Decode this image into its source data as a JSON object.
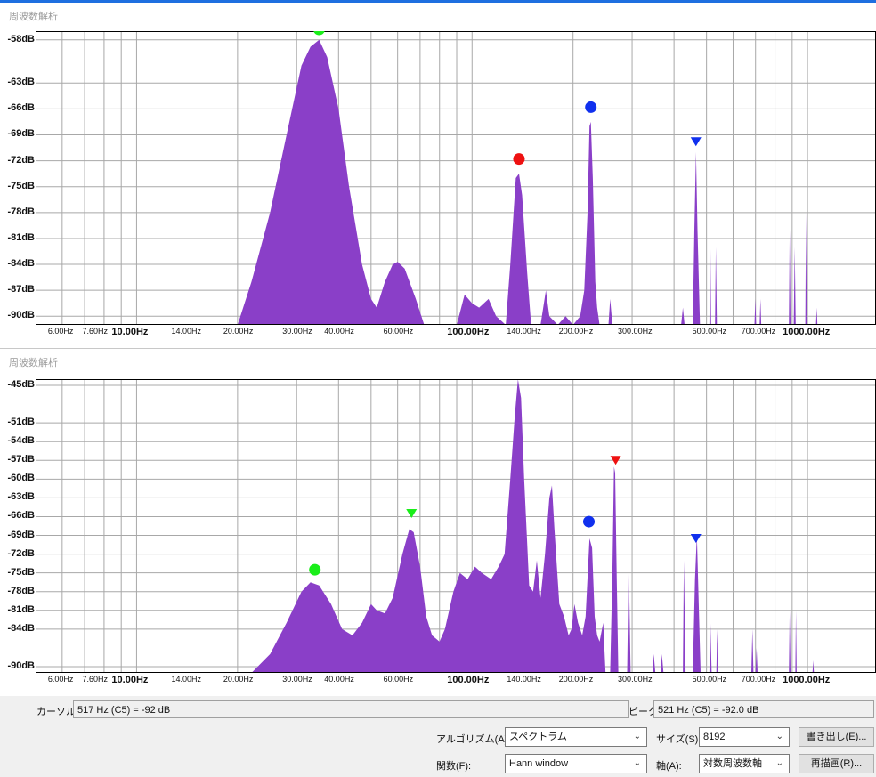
{
  "panel_title": "周波数解析",
  "colors": {
    "fill": "#8a3fc8",
    "grid": "#a8a8a8",
    "green": "#1aee1a",
    "red": "#ee1111",
    "blue": "#1030ee"
  },
  "x_ticks": [
    "6.00Hz",
    "7.60Hz",
    "10.00Hz",
    "14.00Hz",
    "20.00Hz",
    "30.00Hz",
    "40.00Hz",
    "60.00Hz",
    "100.00Hz",
    "140.00Hz",
    "200.00Hz",
    "300.00Hz",
    "500.00Hz",
    "700.00Hz",
    "1000.00Hz"
  ],
  "chart_data": [
    {
      "type": "area",
      "y_axis": {
        "scale": "dB",
        "ylim": [
          -91,
          -57
        ],
        "ticks": [
          "-58dB",
          "-63dB",
          "-66dB",
          "-69dB",
          "-72dB",
          "-75dB",
          "-78dB",
          "-81dB",
          "-84dB",
          "-87dB",
          "-90dB"
        ]
      },
      "x_axis": {
        "scale": "log",
        "xlim": [
          5,
          1600
        ],
        "unit": "Hz"
      },
      "series": [
        {
          "points": [
            [
              20,
              -91
            ],
            [
              22,
              -86
            ],
            [
              25,
              -78
            ],
            [
              28,
              -69
            ],
            [
              31,
              -61
            ],
            [
              33,
              -58.8
            ],
            [
              35,
              -58
            ],
            [
              37,
              -60
            ],
            [
              40,
              -66
            ],
            [
              43,
              -75
            ],
            [
              47,
              -84
            ],
            [
              50,
              -88
            ],
            [
              52,
              -89
            ],
            [
              55,
              -86
            ],
            [
              58,
              -84
            ],
            [
              60,
              -83.7
            ],
            [
              63,
              -84.5
            ],
            [
              68,
              -88
            ],
            [
              72,
              -91
            ],
            [
              90,
              -91
            ],
            [
              95,
              -87.5
            ],
            [
              100,
              -88.5
            ],
            [
              105,
              -89
            ],
            [
              112,
              -88
            ],
            [
              118,
              -90
            ],
            [
              126,
              -91
            ],
            [
              130,
              -84
            ],
            [
              135,
              -74
            ],
            [
              138,
              -73.5
            ],
            [
              141,
              -76
            ],
            [
              146,
              -85
            ],
            [
              150,
              -91
            ],
            [
              160,
              -91
            ],
            [
              166,
              -87
            ],
            [
              170,
              -90
            ],
            [
              180,
              -91
            ],
            [
              190,
              -90
            ],
            [
              200,
              -91
            ],
            [
              210,
              -90
            ],
            [
              216,
              -87
            ],
            [
              221,
              -78
            ],
            [
              224,
              -68
            ],
            [
              226,
              -67.5
            ],
            [
              229,
              -74
            ],
            [
              233,
              -86
            ],
            [
              236,
              -89
            ],
            [
              240,
              -91
            ],
            [
              255,
              -91
            ],
            [
              258,
              -88
            ],
            [
              262,
              -91
            ],
            [
              420,
              -91
            ],
            [
              425,
              -89
            ],
            [
              430,
              -91
            ],
            [
              455,
              -91
            ],
            [
              460,
              -80
            ],
            [
              465,
              -71
            ],
            [
              470,
              -80
            ],
            [
              478,
              -91
            ],
            [
              510,
              -91
            ],
            [
              513,
              -80
            ],
            [
              516,
              -91
            ],
            [
              530,
              -91
            ],
            [
              533,
              -82
            ],
            [
              537,
              -91
            ],
            [
              695,
              -91
            ],
            [
              699,
              -88
            ],
            [
              703,
              -91
            ],
            [
              720,
              -91
            ],
            [
              724,
              -88
            ],
            [
              728,
              -91
            ],
            [
              880,
              -91
            ],
            [
              885,
              -80
            ],
            [
              890,
              -91
            ],
            [
              910,
              -91
            ],
            [
              916,
              -82
            ],
            [
              922,
              -91
            ],
            [
              985,
              -91
            ],
            [
              990,
              -78
            ],
            [
              995,
              -91
            ],
            [
              1060,
              -91
            ],
            [
              1065,
              -89
            ],
            [
              1070,
              -91
            ]
          ]
        }
      ],
      "markers": [
        {
          "shape": "circle",
          "color": "green",
          "x": 35,
          "y": -56.8
        },
        {
          "shape": "circle",
          "color": "red",
          "x": 138,
          "y": -71.8
        },
        {
          "shape": "circle",
          "color": "blue",
          "x": 226,
          "y": -65.8
        },
        {
          "shape": "triangle",
          "color": "blue",
          "x": 465,
          "y": -69.8
        }
      ]
    },
    {
      "type": "area",
      "y_axis": {
        "scale": "dB",
        "ylim": [
          -91,
          -44
        ],
        "ticks": [
          "-45dB",
          "-51dB",
          "-54dB",
          "-57dB",
          "-60dB",
          "-63dB",
          "-66dB",
          "-69dB",
          "-72dB",
          "-75dB",
          "-78dB",
          "-81dB",
          "-84dB",
          "-90dB"
        ]
      },
      "x_axis": {
        "scale": "log",
        "xlim": [
          5,
          1600
        ],
        "unit": "Hz"
      },
      "series": [
        {
          "points": [
            [
              22,
              -91
            ],
            [
              25,
              -88
            ],
            [
              28,
              -83
            ],
            [
              31,
              -78
            ],
            [
              33,
              -76.5
            ],
            [
              35,
              -77
            ],
            [
              38,
              -80
            ],
            [
              41,
              -84
            ],
            [
              44,
              -85
            ],
            [
              47,
              -83
            ],
            [
              50,
              -80
            ],
            [
              52,
              -81
            ],
            [
              55,
              -81.5
            ],
            [
              58,
              -79
            ],
            [
              62,
              -72
            ],
            [
              65,
              -68
            ],
            [
              67,
              -68.5
            ],
            [
              70,
              -74
            ],
            [
              73,
              -82
            ],
            [
              76,
              -85
            ],
            [
              80,
              -86
            ],
            [
              83,
              -84
            ],
            [
              88,
              -78
            ],
            [
              92,
              -75
            ],
            [
              97,
              -76
            ],
            [
              102,
              -74
            ],
            [
              107,
              -75
            ],
            [
              114,
              -76
            ],
            [
              120,
              -74
            ],
            [
              125,
              -72
            ],
            [
              130,
              -60
            ],
            [
              134,
              -50
            ],
            [
              137,
              -44
            ],
            [
              140,
              -47
            ],
            [
              143,
              -60
            ],
            [
              148,
              -77
            ],
            [
              152,
              -78
            ],
            [
              156,
              -73
            ],
            [
              160,
              -79
            ],
            [
              165,
              -72
            ],
            [
              170,
              -63
            ],
            [
              173,
              -61
            ],
            [
              176,
              -68
            ],
            [
              182,
              -80
            ],
            [
              188,
              -82
            ],
            [
              194,
              -85
            ],
            [
              198,
              -84
            ],
            [
              202,
              -80
            ],
            [
              207,
              -83
            ],
            [
              213,
              -85
            ],
            [
              218,
              -82
            ],
            [
              224,
              -69.5
            ],
            [
              228,
              -71
            ],
            [
              232,
              -82
            ],
            [
              236,
              -85
            ],
            [
              240,
              -86
            ],
            [
              246,
              -83
            ],
            [
              250,
              -91
            ],
            [
              258,
              -91
            ],
            [
              262,
              -75
            ],
            [
              265,
              -58
            ],
            [
              267,
              -59
            ],
            [
              270,
              -76
            ],
            [
              273,
              -91
            ],
            [
              290,
              -91
            ],
            [
              293,
              -73
            ],
            [
              297,
              -91
            ],
            [
              345,
              -91
            ],
            [
              348,
              -88
            ],
            [
              352,
              -91
            ],
            [
              365,
              -91
            ],
            [
              368,
              -88
            ],
            [
              372,
              -91
            ],
            [
              425,
              -91
            ],
            [
              428,
              -73
            ],
            [
              433,
              -91
            ],
            [
              455,
              -91
            ],
            [
              462,
              -76
            ],
            [
              468,
              -69
            ],
            [
              474,
              -80
            ],
            [
              480,
              -91
            ],
            [
              510,
              -91
            ],
            [
              513,
              -82
            ],
            [
              518,
              -91
            ],
            [
              535,
              -91
            ],
            [
              538,
              -84
            ],
            [
              542,
              -91
            ],
            [
              680,
              -91
            ],
            [
              685,
              -84
            ],
            [
              690,
              -91
            ],
            [
              700,
              -91
            ],
            [
              705,
              -87
            ],
            [
              710,
              -91
            ],
            [
              880,
              -91
            ],
            [
              885,
              -81
            ],
            [
              890,
              -91
            ],
            [
              920,
              -91
            ],
            [
              924,
              -81
            ],
            [
              928,
              -91
            ],
            [
              1035,
              -91
            ],
            [
              1040,
              -89
            ],
            [
              1045,
              -91
            ]
          ]
        }
      ],
      "markers": [
        {
          "shape": "circle",
          "color": "green",
          "x": 34,
          "y": -74.5
        },
        {
          "shape": "triangle",
          "color": "green",
          "x": 66,
          "y": -65.5
        },
        {
          "shape": "circle",
          "color": "red",
          "x": 137,
          "y": -42.6
        },
        {
          "shape": "triangle",
          "color": "red",
          "x": 268,
          "y": -57
        },
        {
          "shape": "circle",
          "color": "blue",
          "x": 223,
          "y": -66.8
        },
        {
          "shape": "triangle",
          "color": "blue",
          "x": 465,
          "y": -69.5
        }
      ]
    }
  ],
  "bottom": {
    "cursor_label": "カーソル:",
    "cursor_value": "517 Hz (C5) = -92 dB",
    "peak_label": "ピーク:",
    "peak_value": "521 Hz (C5) = -92.0 dB",
    "algorithm_label": "アルゴリズム(A):",
    "algorithm_value": "スペクトラム",
    "size_label": "サイズ(S):",
    "size_value": "8192",
    "export_button": "書き出し(E)...",
    "function_label": "関数(F):",
    "function_value": "Hann window",
    "axis_label": "軸(A):",
    "axis_value": "対数周波数軸",
    "replot_button": "再描画(R)..."
  }
}
